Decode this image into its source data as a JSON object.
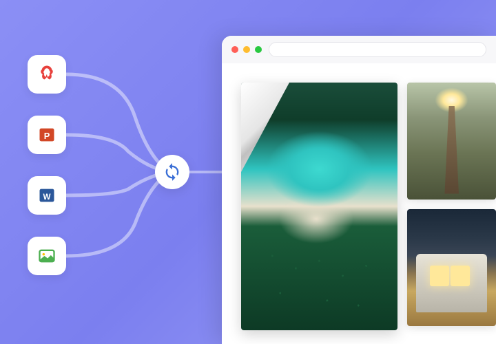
{
  "file_types": [
    {
      "name": "pdf",
      "color": "#E8413C"
    },
    {
      "name": "powerpoint",
      "color": "#D24726"
    },
    {
      "name": "word",
      "color": "#2B579A"
    },
    {
      "name": "image",
      "color": "#4CAF50"
    }
  ],
  "hub": {
    "icon": "convert",
    "color": "#3B6FD6"
  },
  "browser": {
    "traffic": [
      "close",
      "minimize",
      "maximize"
    ],
    "address": ""
  },
  "gallery": {
    "main": "aerial-beach-forest",
    "thumbnails": [
      "suspension-bridge-sunlight",
      "camper-van-night"
    ]
  }
}
